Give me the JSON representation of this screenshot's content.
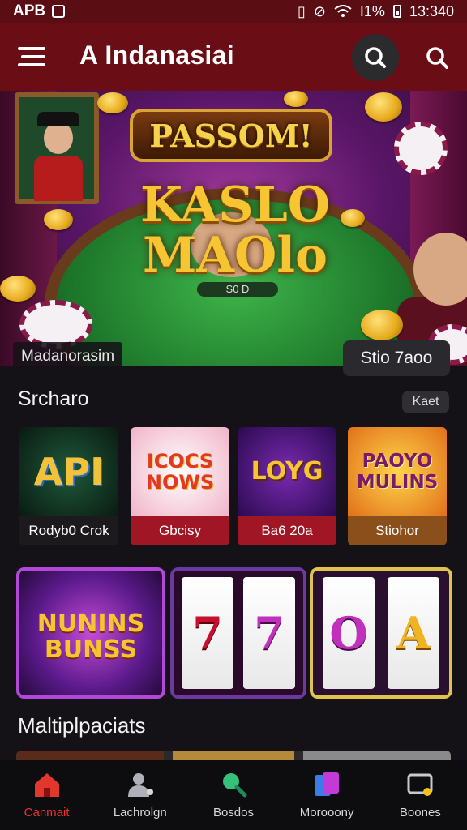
{
  "status_bar": {
    "carrier": "APB",
    "battery": "I1%",
    "time": "13:340"
  },
  "header": {
    "title": "A Indanasiai"
  },
  "banner": {
    "plaque_text": "PASSOM!",
    "logo_line1": "KASLO",
    "logo_line2": "MAOlo",
    "table_text": "S0 D",
    "tag": "Madanorasim",
    "button": "Stio 7aoo"
  },
  "section1": {
    "title": "Srcharo",
    "more": "Kaet",
    "tiles": [
      {
        "art": "API",
        "caption": "Rodyb0 Crok",
        "color": "#0f2f25",
        "caption_bg": "#1c1a1d"
      },
      {
        "art": "ICOCS NOWS",
        "caption": "Gbcisy",
        "color": "#f4d9e2",
        "caption_bg": "#a11624"
      },
      {
        "art": "LOYG",
        "caption": "Ba6 20a",
        "color": "#4a1478",
        "caption_bg": "#a11624"
      },
      {
        "art": "PAOYO MULINS",
        "caption": "Stiohor",
        "color": "#e9891b",
        "caption_bg": "#8a4f1a"
      }
    ]
  },
  "slots": {
    "slot1_text": "NUNINS BUNSS",
    "slot2_reels": [
      "7",
      "7"
    ],
    "slot3_reels": [
      "O",
      "A"
    ]
  },
  "section2": {
    "title": "Maltiplpaciats"
  },
  "nav": [
    {
      "label": "Canmait",
      "icon": "home-icon"
    },
    {
      "label": "Lachrolgn",
      "icon": "profile-icon"
    },
    {
      "label": "Bosdos",
      "icon": "search-icon"
    },
    {
      "label": "Morooony",
      "icon": "cards-icon"
    },
    {
      "label": "Boones",
      "icon": "tv-icon"
    }
  ],
  "colors": {
    "header": "#6b0d14",
    "accent": "#e8332f",
    "background": "#141217"
  }
}
